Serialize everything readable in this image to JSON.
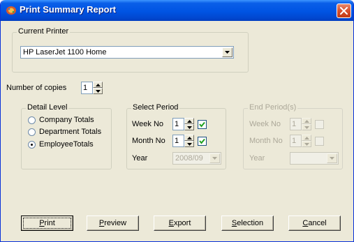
{
  "window": {
    "title": "Print Summary Report"
  },
  "printer": {
    "legend": "Current Printer",
    "selected": "HP LaserJet 1100 Home"
  },
  "copies": {
    "label": "Number of copies",
    "value": "1"
  },
  "detail_level": {
    "legend": "Detail Level",
    "options": [
      {
        "label": "Company Totals",
        "selected": false
      },
      {
        "label": "Department Totals",
        "selected": false
      },
      {
        "label": "EmployeeTotals",
        "selected": true
      }
    ]
  },
  "select_period": {
    "legend": "Select Period",
    "week_label": "Week No",
    "week_value": "1",
    "week_checked": true,
    "month_label": "Month No",
    "month_value": "1",
    "month_checked": true,
    "year_label": "Year",
    "year_value": "2008/09"
  },
  "end_period": {
    "legend": "End Period(s)",
    "week_label": "Week No",
    "week_value": "1",
    "week_checked": false,
    "month_label": "Month No",
    "month_value": "1",
    "month_checked": false,
    "year_label": "Year",
    "year_value": ""
  },
  "buttons": {
    "print": {
      "first": "P",
      "rest": "rint"
    },
    "preview": {
      "first": "P",
      "rest": "review"
    },
    "export": {
      "first": "E",
      "rest": "xport"
    },
    "selection": {
      "first": "S",
      "rest": "election"
    },
    "cancel": {
      "first": "C",
      "rest": "ancel"
    }
  },
  "colors": {
    "titlebar": "#0054E3",
    "dialog_bg": "#ECE9D8",
    "close_button": "#D9502C",
    "disabled_text": "#ACA899"
  }
}
